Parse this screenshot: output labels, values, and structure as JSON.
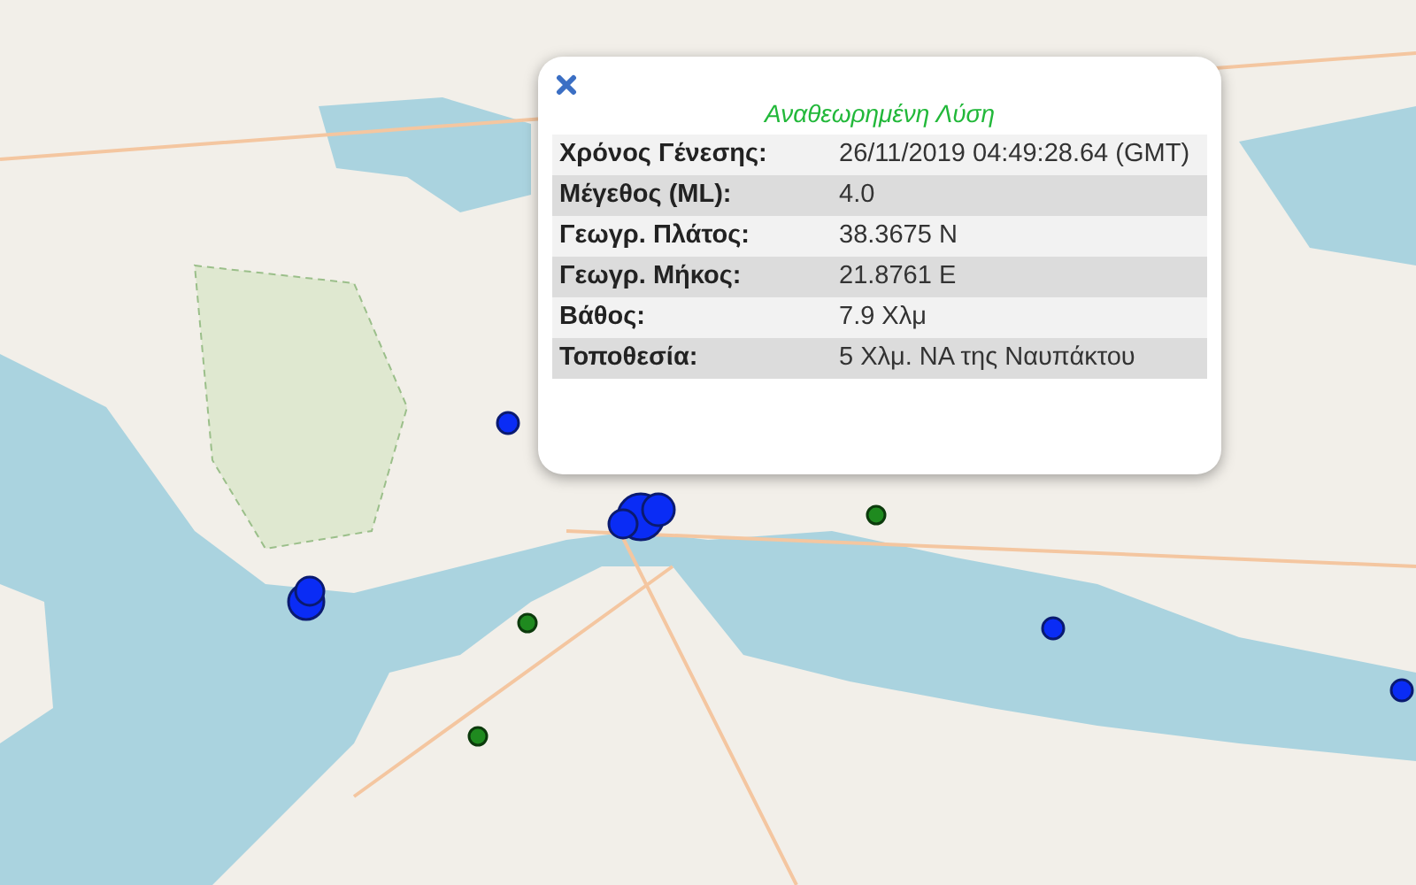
{
  "popup": {
    "title": "Αναθεωρημένη Λύση",
    "rows": [
      {
        "label": "Χρόνος Γένεσης:",
        "value": "26/11/2019 04:49:28.64 (GMT)"
      },
      {
        "label": "Μέγεθος (ML):",
        "value": "4.0"
      },
      {
        "label": "Γεωγρ. Πλάτος:",
        "value": "38.3675 N"
      },
      {
        "label": "Γεωγρ. Μήκος:",
        "value": "21.8761 E"
      },
      {
        "label": "Βάθος:",
        "value": "7.9 Χλμ"
      },
      {
        "label": "Τοποθεσία:",
        "value": "5 Χλμ. ΝΑ της Ναυπάκτου"
      }
    ]
  }
}
